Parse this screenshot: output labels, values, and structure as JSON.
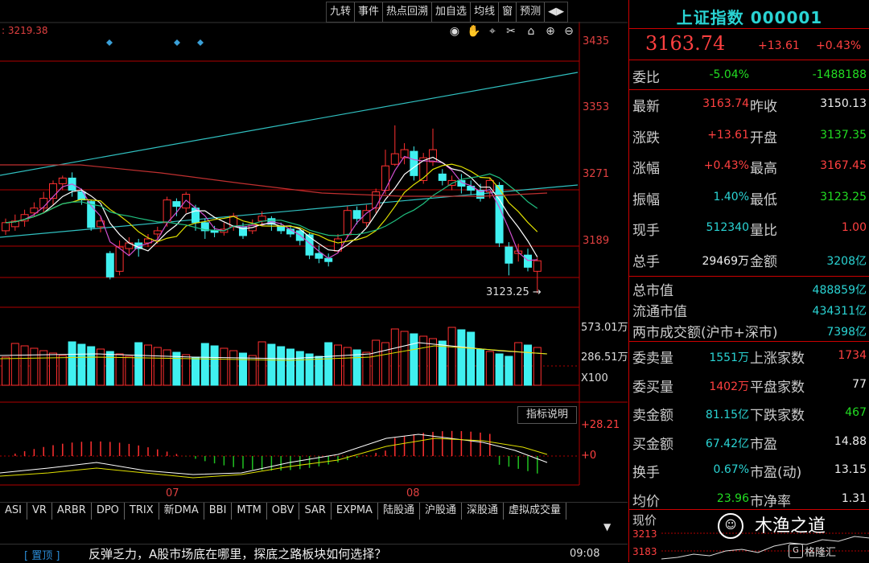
{
  "toolbar": {
    "items": [
      "九转",
      "事件",
      "热点回溯",
      "加自选",
      "均线",
      "窗",
      "预测",
      "◀▶"
    ]
  },
  "chart": {
    "top_left_value": ": 3219.38",
    "price_axis": [
      "3435",
      "3353",
      "3271",
      "3189"
    ],
    "low_marker": "3123.25",
    "volume_axis": [
      "573.01万",
      "286.51万",
      "X100"
    ],
    "indicator_axis": [
      "+28.21",
      "+0"
    ],
    "x_labels": [
      "07",
      "08"
    ],
    "indicator_button": "指标说明",
    "colors": {
      "up": "#ff3030",
      "down": "#40f0f0",
      "grid": "#b00000",
      "ma_white": "#ffffff",
      "ma_yellow": "#e0e000",
      "ma_purple": "#d050d0",
      "ma_green": "#20c080",
      "trend": "#30c0c0"
    }
  },
  "tabs": [
    "ASI",
    "VR",
    "ARBR",
    "DPO",
    "TRIX",
    "新DMA",
    "BBI",
    "MTM",
    "OBV",
    "SAR",
    "EXPMA",
    "陆股通",
    "沪股通",
    "深股通",
    "虚拟成交量"
  ],
  "news": {
    "tag": "[ 置顶 ]",
    "text": "反弹乏力，A股市场底在哪里，探底之路板块如何选择？",
    "time": "09:08"
  },
  "panel": {
    "title": "上证指数 000001",
    "price": "3163.74",
    "change": "+13.61",
    "change_pct": "+0.43%",
    "weibi": {
      "label": "委比",
      "v1": "-5.04%",
      "v2": "-1488188"
    },
    "rows": [
      {
        "l1": "最新",
        "v1": "3163.74",
        "c1": "red",
        "l2": "昨收",
        "v2": "3150.13",
        "c2": "white"
      },
      {
        "l1": "涨跌",
        "v1": "+13.61",
        "c1": "red",
        "l2": "开盘",
        "v2": "3137.35",
        "c2": "green"
      },
      {
        "l1": "涨幅",
        "v1": "+0.43%",
        "c1": "red",
        "l2": "最高",
        "v2": "3167.45",
        "c2": "red"
      },
      {
        "l1": "振幅",
        "v1": "1.40%",
        "c1": "cyan",
        "l2": "最低",
        "v2": "3123.25",
        "c2": "green"
      },
      {
        "l1": "现手",
        "v1": "512340",
        "c1": "cyan",
        "l2": "量比",
        "v2": "1.00",
        "c2": "red"
      },
      {
        "l1": "总手",
        "v1": "29469万",
        "c1": "white",
        "l2": "金额",
        "v2": "3208亿",
        "c2": "cyan"
      }
    ],
    "market": [
      {
        "l": "总市值",
        "v": "488859亿"
      },
      {
        "l": "流通市值",
        "v": "434311亿"
      },
      {
        "l": "两市成交额(沪市+深市)",
        "v": "7398亿"
      }
    ],
    "rows2": [
      {
        "l1": "委卖量",
        "v1": "1551万",
        "c1": "cyan",
        "l2": "上涨家数",
        "v2": "1734",
        "c2": "red"
      },
      {
        "l1": "委买量",
        "v1": "1402万",
        "c1": "red",
        "l2": "平盘家数",
        "v2": "77",
        "c2": "white"
      },
      {
        "l1": "卖金额",
        "v1": "81.15亿",
        "c1": "cyan",
        "l2": "下跌家数",
        "v2": "467",
        "c2": "green"
      },
      {
        "l1": "买金额",
        "v1": "67.42亿",
        "c1": "cyan",
        "l2": "市盈",
        "v2": "14.88",
        "c2": "white"
      },
      {
        "l1": "换手",
        "v1": "0.67%",
        "c1": "cyan",
        "l2": "市盈(动)",
        "v2": "13.15",
        "c2": "white"
      },
      {
        "l1": "均价",
        "v1": "23.96",
        "c1": "green",
        "l2": "市净率",
        "v2": "1.31",
        "c2": "white"
      }
    ],
    "partial_label": "现价",
    "mini_axis": [
      "3213",
      "3183"
    ],
    "watermark": "木渔之道",
    "source": "格隆汇"
  }
}
